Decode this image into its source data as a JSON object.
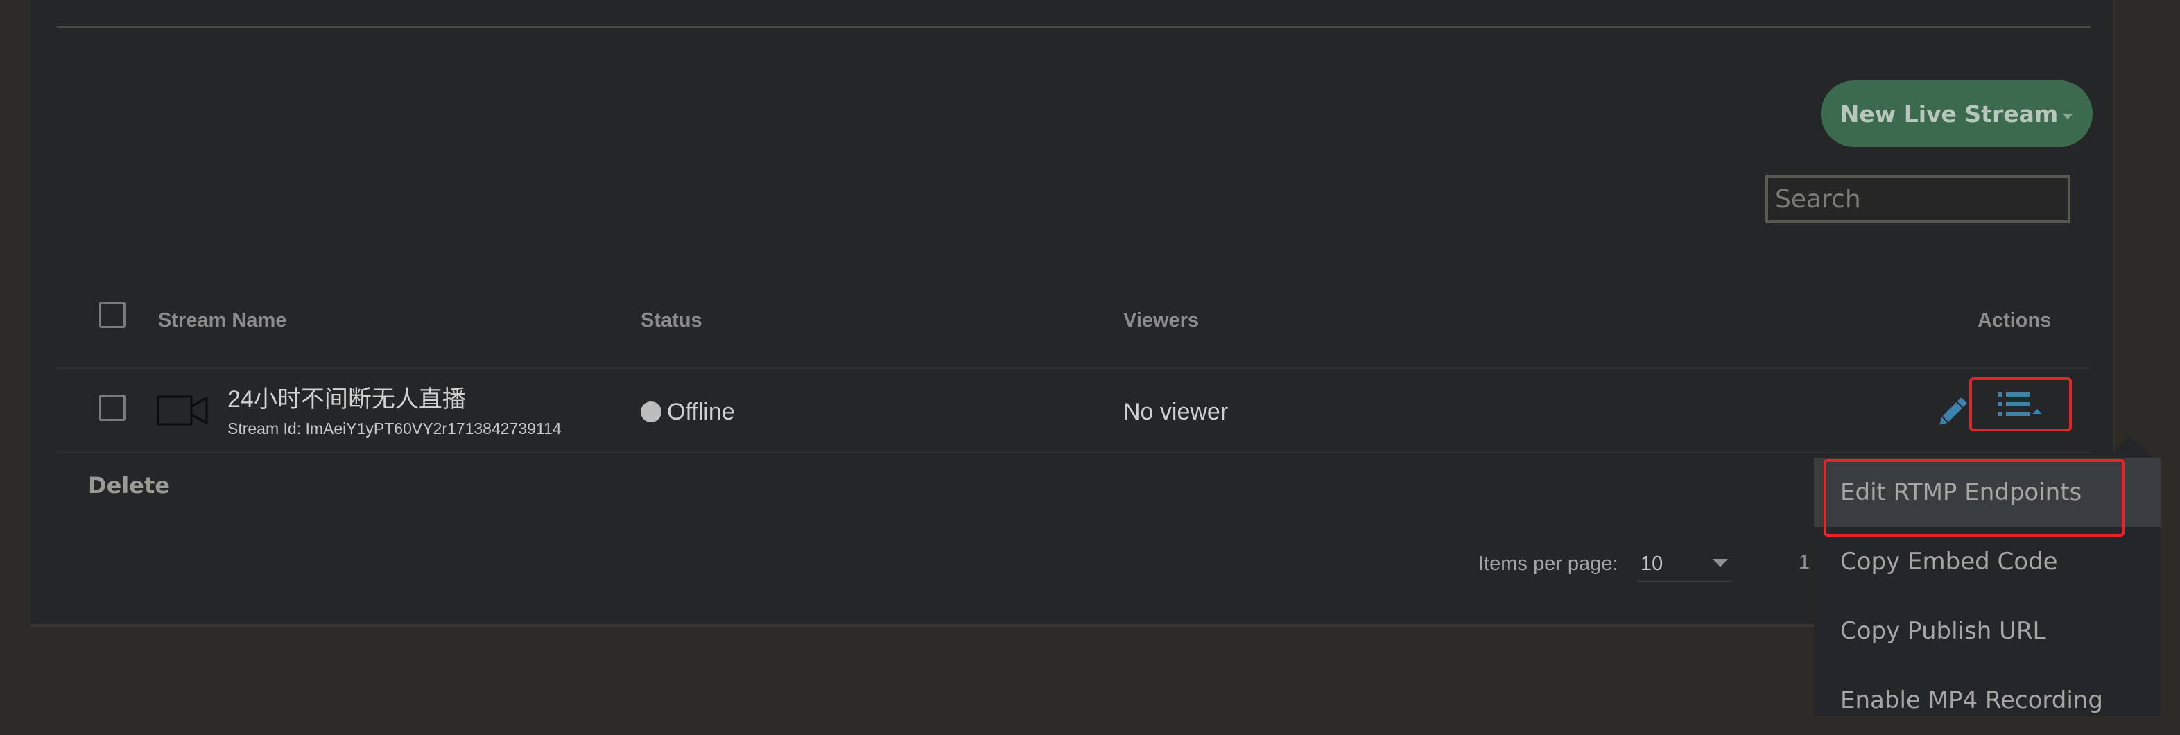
{
  "toolbar": {
    "new_stream_label": "New Live Stream",
    "search_placeholder": "Search"
  },
  "table": {
    "columns": {
      "name": "Stream Name",
      "status": "Status",
      "viewers": "Viewers",
      "actions": "Actions"
    },
    "rows": [
      {
        "name": "24小时不间断无人直播",
        "stream_id": "Stream Id: ImAeiY1yPT60VY2r1713842739114",
        "status": "Offline",
        "viewers": "No viewer"
      }
    ],
    "delete_label": "Delete"
  },
  "pagination": {
    "items_per_page_label": "Items per page:",
    "items_per_page_value": "10",
    "page_text": "1"
  },
  "actions_menu": {
    "items": [
      {
        "label": "Edit RTMP Endpoints",
        "active": true
      },
      {
        "label": "Copy Embed Code"
      },
      {
        "label": "Copy Publish URL"
      },
      {
        "label": "Enable MP4 Recording"
      }
    ]
  },
  "colors": {
    "page_bg": "#2d2b25",
    "panel_bg": "#252628",
    "primary_button": "#3c6a4f",
    "icon_blue": "#3e83b0",
    "highlight_red": "#e0282c",
    "status_offline": "#bdbdbd"
  },
  "icons": {
    "camera": "video-camera-icon",
    "edit": "pencil-icon",
    "actions": "list-menu-icon",
    "status": "status-dot"
  }
}
